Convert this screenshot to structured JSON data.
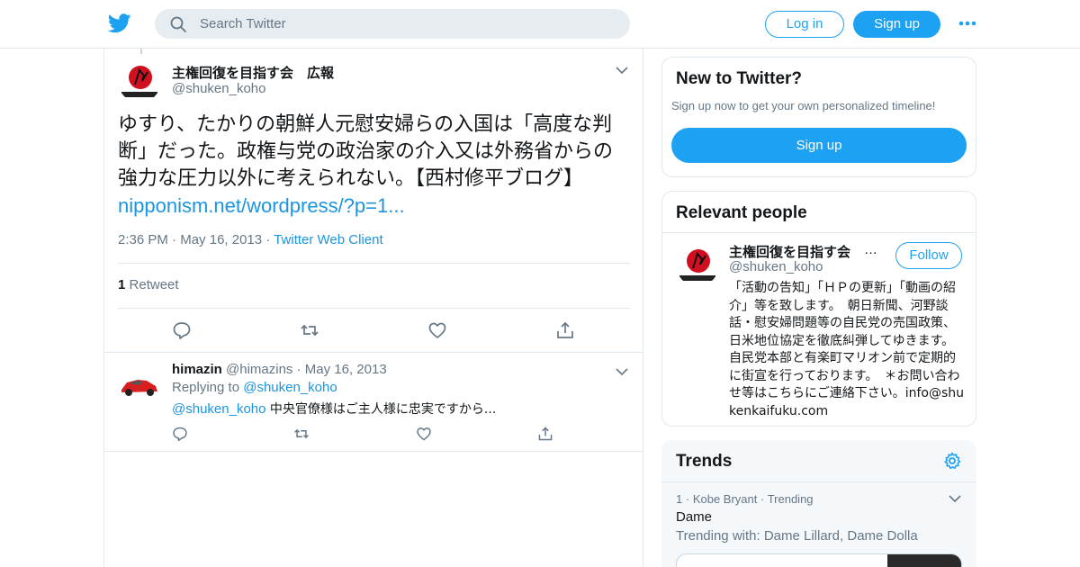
{
  "header": {
    "search_placeholder": "Search Twitter",
    "login_label": "Log in",
    "signup_label": "Sign up"
  },
  "tweet": {
    "display_name": "主権回復を目指す会　広報",
    "handle": "@shuken_koho",
    "text": "ゆすり、たかりの朝鮮人元慰安婦らの入国は「高度な判断」だった。政権与党の政治家の介入又は外務省からの強力な圧力以外に考えられない。【西村修平ブログ】",
    "link": "nipponism.net/wordpress/?p=1...",
    "time": "2:36 PM",
    "date": "May 16, 2013",
    "source": "Twitter Web Client",
    "retweet_count": "1",
    "retweet_label": "Retweet"
  },
  "reply": {
    "display_name": "himazin",
    "handle": "@himazins",
    "date": "May 16, 2013",
    "replying_to_label": "Replying to",
    "replying_to_handle": "@shuken_koho",
    "mention": "@shuken_koho",
    "text": "中央官僚様はご主人様に忠実ですから..."
  },
  "signup_card": {
    "title": "New to Twitter?",
    "subtitle": "Sign up now to get your own personalized timeline!",
    "button": "Sign up"
  },
  "relevant_people": {
    "title": "Relevant people",
    "name": "主権回復を目指す会",
    "name_ellipsis": "…",
    "handle": "@shuken_koho",
    "follow_label": "Follow",
    "bio": "「活動の告知」「ＨＰの更新」「動画の紹介」等を致します。　朝日新聞、河野談話・慰安婦問題等の自民党の売国政策、日米地位協定を徹底糾弾してゆきます。　自民党本部と有楽町マリオン前で定期的に街宣を行っております。　＊お問い合わせ等はこちらにご連絡下さい。info@shukenkaifuku.com"
  },
  "trends": {
    "title": "Trends",
    "items": [
      {
        "rank": "1",
        "context": "Kobe Bryant",
        "status": "Trending",
        "name": "Dame",
        "trending_with": "Trending with: Dame Lillard, Dame Dolla"
      }
    ]
  },
  "colors": {
    "accent": "#1da1f2",
    "link": "#1b95e0",
    "secondary_text": "#657786",
    "border": "#e1e8ed"
  },
  "icons": [
    "twitter-bird-icon",
    "search-icon",
    "more-icon",
    "chevron-down-icon",
    "reply-icon",
    "retweet-icon",
    "like-icon",
    "share-icon",
    "gear-icon"
  ]
}
